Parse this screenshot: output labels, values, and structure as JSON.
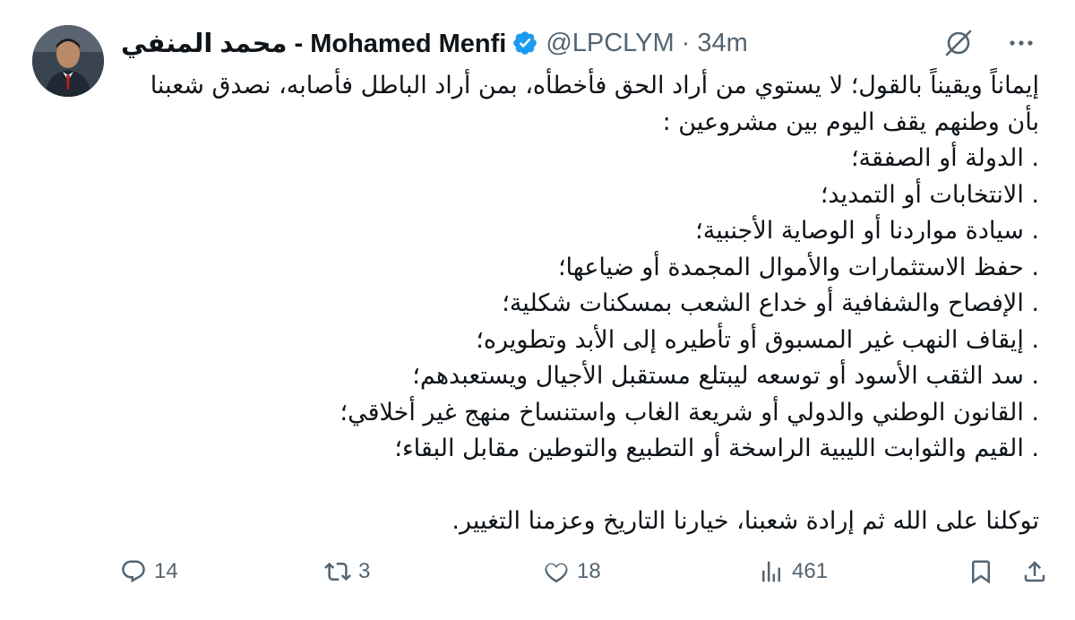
{
  "tweet": {
    "author": {
      "display_name": "محمد المنفي - Mohamed Menfi",
      "handle": "@LPCLYM",
      "separator": "·",
      "time": "34m",
      "verified": true
    },
    "lines": [
      "إيماناً ويقيناً بالقول؛ لا يستوي من أراد الحق فأخطأه، بمن أراد الباطل فأصابه، نصدق شعبنا",
      "بأن وطنهم يقف اليوم بين مشروعين :",
      ". الدولة أو الصفقة؛",
      ". الانتخابات أو التمديد؛",
      ". سيادة مواردنا أو الوصاية الأجنبية؛",
      ". حفظ الاستثمارات والأموال المجمدة أو ضياعها؛",
      ". الإفصاح والشفافية أو خداع الشعب بمسكنات شكلية؛",
      ". إيقاف النهب غير المسبوق أو تأطيره إلى الأبد وتطويره؛",
      ". سد الثقب الأسود أو توسعه ليبتلع مستقبل الأجيال ويستعبدهم؛",
      ". القانون الوطني والدولي  أو شريعة الغاب واستنساخ منهج غير أخلاقي؛",
      ". القيم والثوابت الليبية الراسخة أو التطبيع والتوطين مقابل البقاء؛"
    ],
    "closing": "توكلنا على الله ثم إرادة شعبنا، خيارنا التاريخ وعزمنا التغيير.",
    "stats": {
      "replies": "14",
      "retweets": "3",
      "likes": "18",
      "views": "461"
    }
  },
  "icons": {
    "verified": "verified-badge-icon",
    "grok": "grok-icon",
    "more": "more-dots-icon",
    "reply": "reply-icon",
    "retweet": "retweet-icon",
    "like": "heart-icon",
    "views": "views-chart-icon",
    "bookmark": "bookmark-icon",
    "share": "share-icon"
  },
  "colors": {
    "text": "#0f1419",
    "secondary": "#536471",
    "verified": "#1d9bf0"
  }
}
